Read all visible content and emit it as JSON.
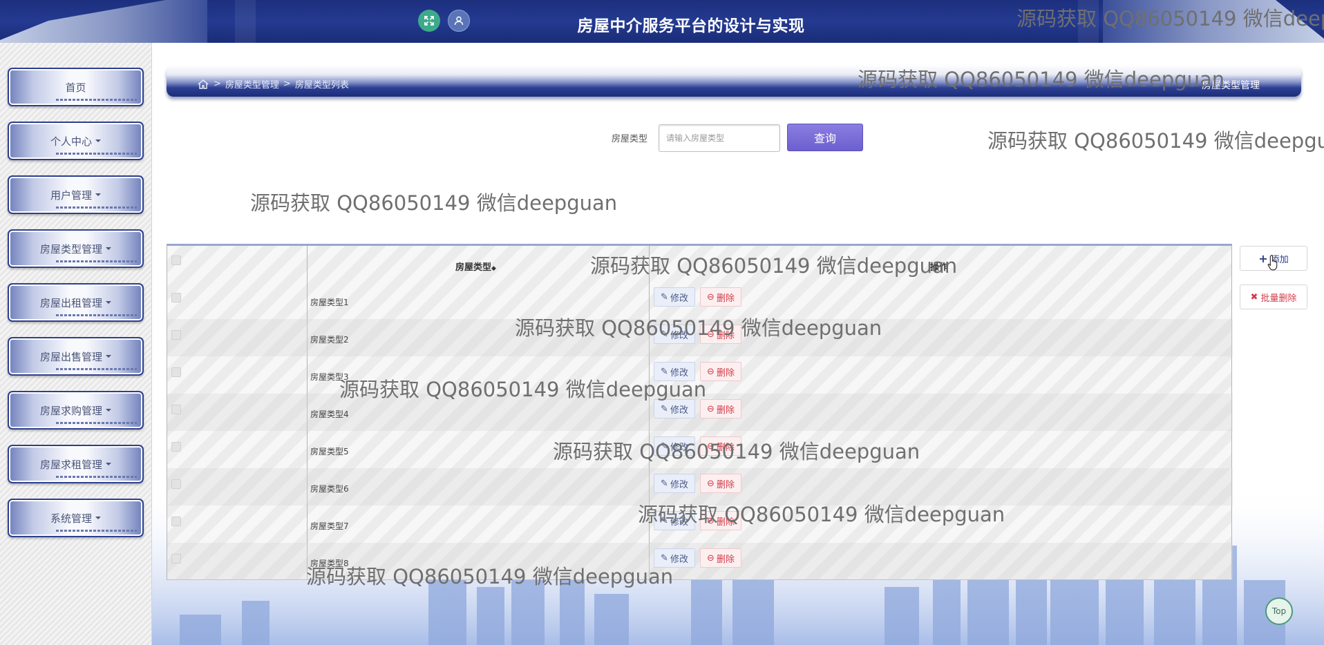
{
  "header": {
    "title": "房屋中介服务平台的设计与实现"
  },
  "sidebar": {
    "items": [
      {
        "label": "首页",
        "has_caret": false
      },
      {
        "label": "个人中心",
        "has_caret": true
      },
      {
        "label": "用户管理",
        "has_caret": true
      },
      {
        "label": "房屋类型管理",
        "has_caret": true
      },
      {
        "label": "房屋出租管理",
        "has_caret": true
      },
      {
        "label": "房屋出售管理",
        "has_caret": true
      },
      {
        "label": "房屋求购管理",
        "has_caret": true
      },
      {
        "label": "房屋求租管理",
        "has_caret": true
      },
      {
        "label": "系统管理",
        "has_caret": true
      }
    ]
  },
  "breadcrumb": {
    "items": [
      "房屋类型管理",
      "房屋类型列表"
    ],
    "separator": ">",
    "right_label": "房屋类型管理"
  },
  "search": {
    "label": "房屋类型",
    "placeholder": "请输入房屋类型",
    "button_label": "查询"
  },
  "table": {
    "columns": [
      "房屋类型",
      "操作"
    ],
    "sort_indicator": "◆",
    "rows": [
      {
        "name": "房屋类型1"
      },
      {
        "name": "房屋类型2"
      },
      {
        "name": "房屋类型3"
      },
      {
        "name": "房屋类型4"
      },
      {
        "name": "房屋类型5"
      },
      {
        "name": "房屋类型6"
      },
      {
        "name": "房屋类型7"
      },
      {
        "name": "房屋类型8"
      }
    ],
    "edit_label": "修改",
    "delete_label": "删除"
  },
  "actions": {
    "add_label": "添加",
    "batch_delete_label": "批量删除"
  },
  "top_button": "Top",
  "watermark": "源码获取 QQ86050149 微信deepguan",
  "colors": {
    "header_bg": "#1c2f7e",
    "nav_border": "#2d3f8e",
    "search_button": "#6c5fcf",
    "delete_red": "#d43c4a",
    "top_button_green": "#4c9a7a"
  }
}
